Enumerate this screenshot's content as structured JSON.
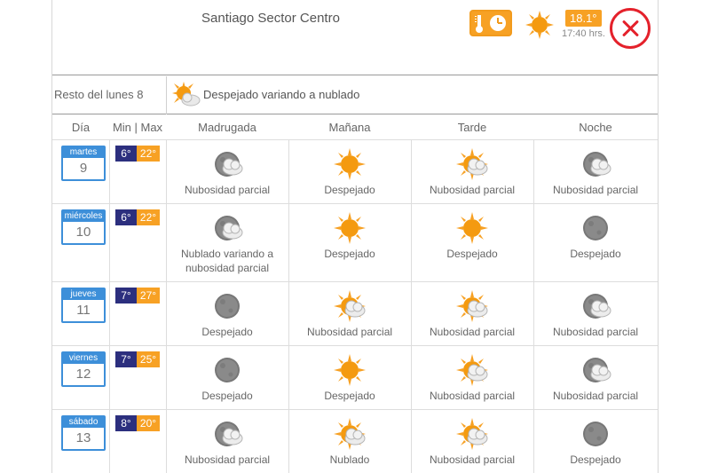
{
  "header": {
    "location": "Santiago Sector Centro",
    "current_temp": "18.1°",
    "update_time": "17:40 hrs.",
    "current_icon": "sun-icon"
  },
  "rest_of_day": {
    "label": "Resto del lunes 8",
    "condition": "Despejado variando a nublado",
    "icon": "sun-cloud-icon"
  },
  "columns": {
    "day": "Día",
    "minmax": "Min | Max",
    "periods": [
      "Madrugada",
      "Mañana",
      "Tarde",
      "Noche"
    ]
  },
  "colors": {
    "sun": "#f7a124",
    "min": "#2c2f7e",
    "calendar": "#3d8fd9",
    "close": "#e4212b"
  },
  "days": [
    {
      "weekday": "martes",
      "day": "9",
      "min": "6°",
      "max": "22°",
      "periods": [
        {
          "icon": "moon-cloud-icon",
          "text": "Nubosidad parcial"
        },
        {
          "icon": "sun-icon",
          "text": "Despejado"
        },
        {
          "icon": "sun-cloud-icon",
          "text": "Nubosidad parcial"
        },
        {
          "icon": "moon-cloud-icon",
          "text": "Nubosidad parcial"
        }
      ]
    },
    {
      "weekday": "miércoles",
      "day": "10",
      "min": "6°",
      "max": "22°",
      "periods": [
        {
          "icon": "moon-cloud-icon",
          "text": "Nublado variando a nubosidad parcial"
        },
        {
          "icon": "sun-icon",
          "text": "Despejado"
        },
        {
          "icon": "sun-icon",
          "text": "Despejado"
        },
        {
          "icon": "moon-icon",
          "text": "Despejado"
        }
      ]
    },
    {
      "weekday": "jueves",
      "day": "11",
      "min": "7°",
      "max": "27°",
      "periods": [
        {
          "icon": "moon-icon",
          "text": "Despejado"
        },
        {
          "icon": "sun-cloud-icon",
          "text": "Nubosidad parcial"
        },
        {
          "icon": "sun-cloud-icon",
          "text": "Nubosidad parcial"
        },
        {
          "icon": "moon-cloud-icon",
          "text": "Nubosidad parcial"
        }
      ]
    },
    {
      "weekday": "viernes",
      "day": "12",
      "min": "7°",
      "max": "25°",
      "periods": [
        {
          "icon": "moon-icon",
          "text": "Despejado"
        },
        {
          "icon": "sun-icon",
          "text": "Despejado"
        },
        {
          "icon": "sun-cloud-icon",
          "text": "Nubosidad parcial"
        },
        {
          "icon": "moon-cloud-icon",
          "text": "Nubosidad parcial"
        }
      ]
    },
    {
      "weekday": "sábado",
      "day": "13",
      "min": "8°",
      "max": "20°",
      "periods": [
        {
          "icon": "moon-cloud-icon",
          "text": "Nubosidad parcial"
        },
        {
          "icon": "sun-cloud-icon",
          "text": "Nublado"
        },
        {
          "icon": "sun-cloud-icon",
          "text": "Nubosidad parcial"
        },
        {
          "icon": "moon-icon",
          "text": "Despejado"
        }
      ]
    }
  ]
}
